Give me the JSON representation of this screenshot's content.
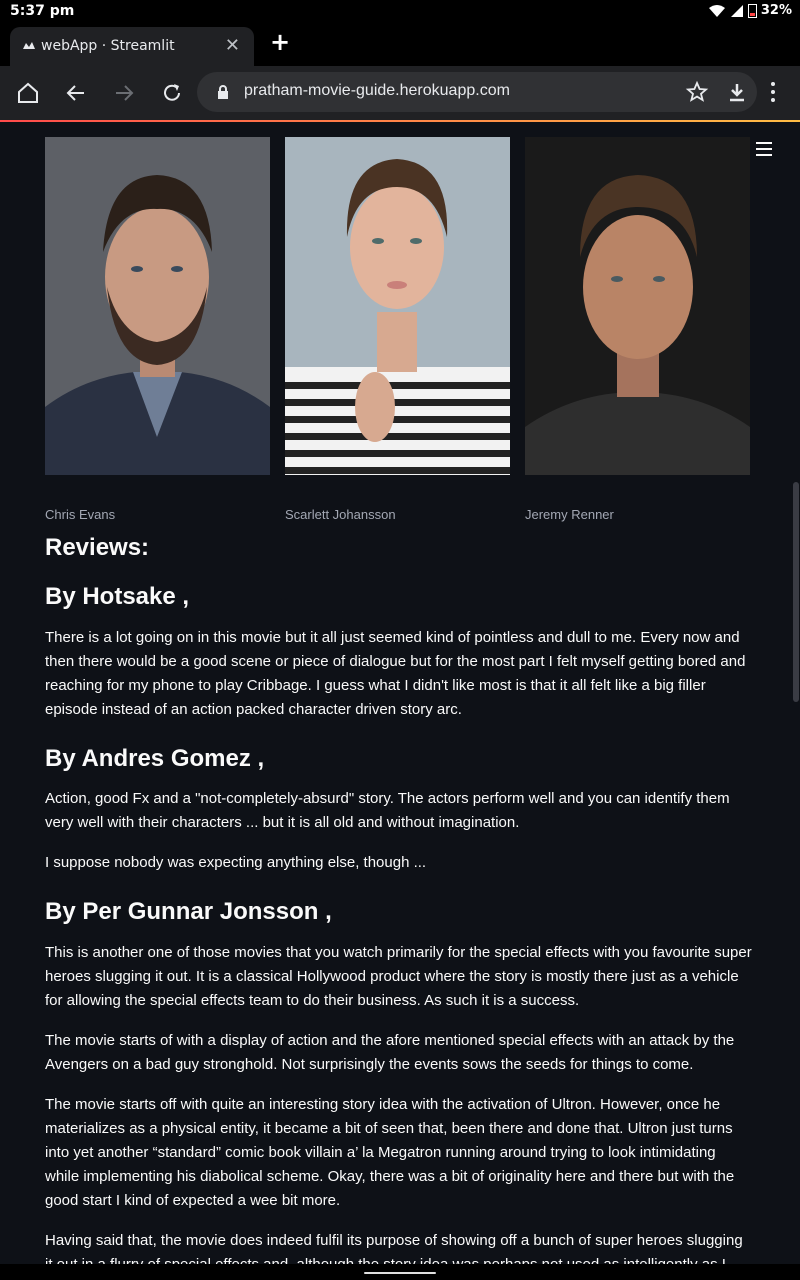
{
  "status": {
    "time": "5:37 pm",
    "battery": "32%"
  },
  "browser": {
    "tab_title": "webApp · Streamlit",
    "url": "pratham-movie-guide.herokuapp.com"
  },
  "cast": [
    {
      "name": "Chris Evans"
    },
    {
      "name": "Scarlett Johansson"
    },
    {
      "name": "Jeremy Renner"
    }
  ],
  "reviews": {
    "heading": "Reviews:",
    "items": [
      {
        "author": "By Hotsake ,",
        "paragraphs": [
          "There is a lot going on in this movie but it all just seemed kind of pointless and dull to me. Every now and then there would be a good scene or piece of dialogue but for the most part I felt myself getting bored and reaching for my phone to play Cribbage. I guess what I didn't like most is that it all felt like a big filler episode instead of an action packed character driven story arc."
        ]
      },
      {
        "author": "By Andres Gomez ,",
        "paragraphs": [
          "Action, good Fx and a \"not-completely-absurd\" story. The actors perform well and you can identify them very well with their characters ... but it is all old and without imagination.",
          "I suppose nobody was expecting anything else, though ..."
        ]
      },
      {
        "author": "By Per Gunnar Jonsson ,",
        "paragraphs": [
          "This is another one of those movies that you watch primarily for the special effects with you favourite super heroes slugging it out. It is a classical Hollywood product where the story is mostly there just as a vehicle for allowing the special effects team to do their business. As such it is a success.",
          "The movie starts of with a display of action and the afore mentioned special effects with an attack by the Avengers on a bad guy stronghold. Not surprisingly the events sows the seeds for things to come.",
          "The movie starts off with quite an interesting story idea with the activation of Ultron. However, once he materializes as a physical entity, it became a bit of seen that, been there and done that. Ultron just turns into yet another “standard” comic book villain a’ la Megatron running around trying to look intimidating while implementing his diabolical scheme. Okay, there was a bit of originality here and there but with the good start I kind of expected a wee bit more.",
          "Having said that, the movie does indeed fulfil its purpose of showing off a bunch of super heroes slugging it out in a flurry of special effects and, although the story idea was perhaps not used as intelligently as I"
        ]
      }
    ]
  }
}
